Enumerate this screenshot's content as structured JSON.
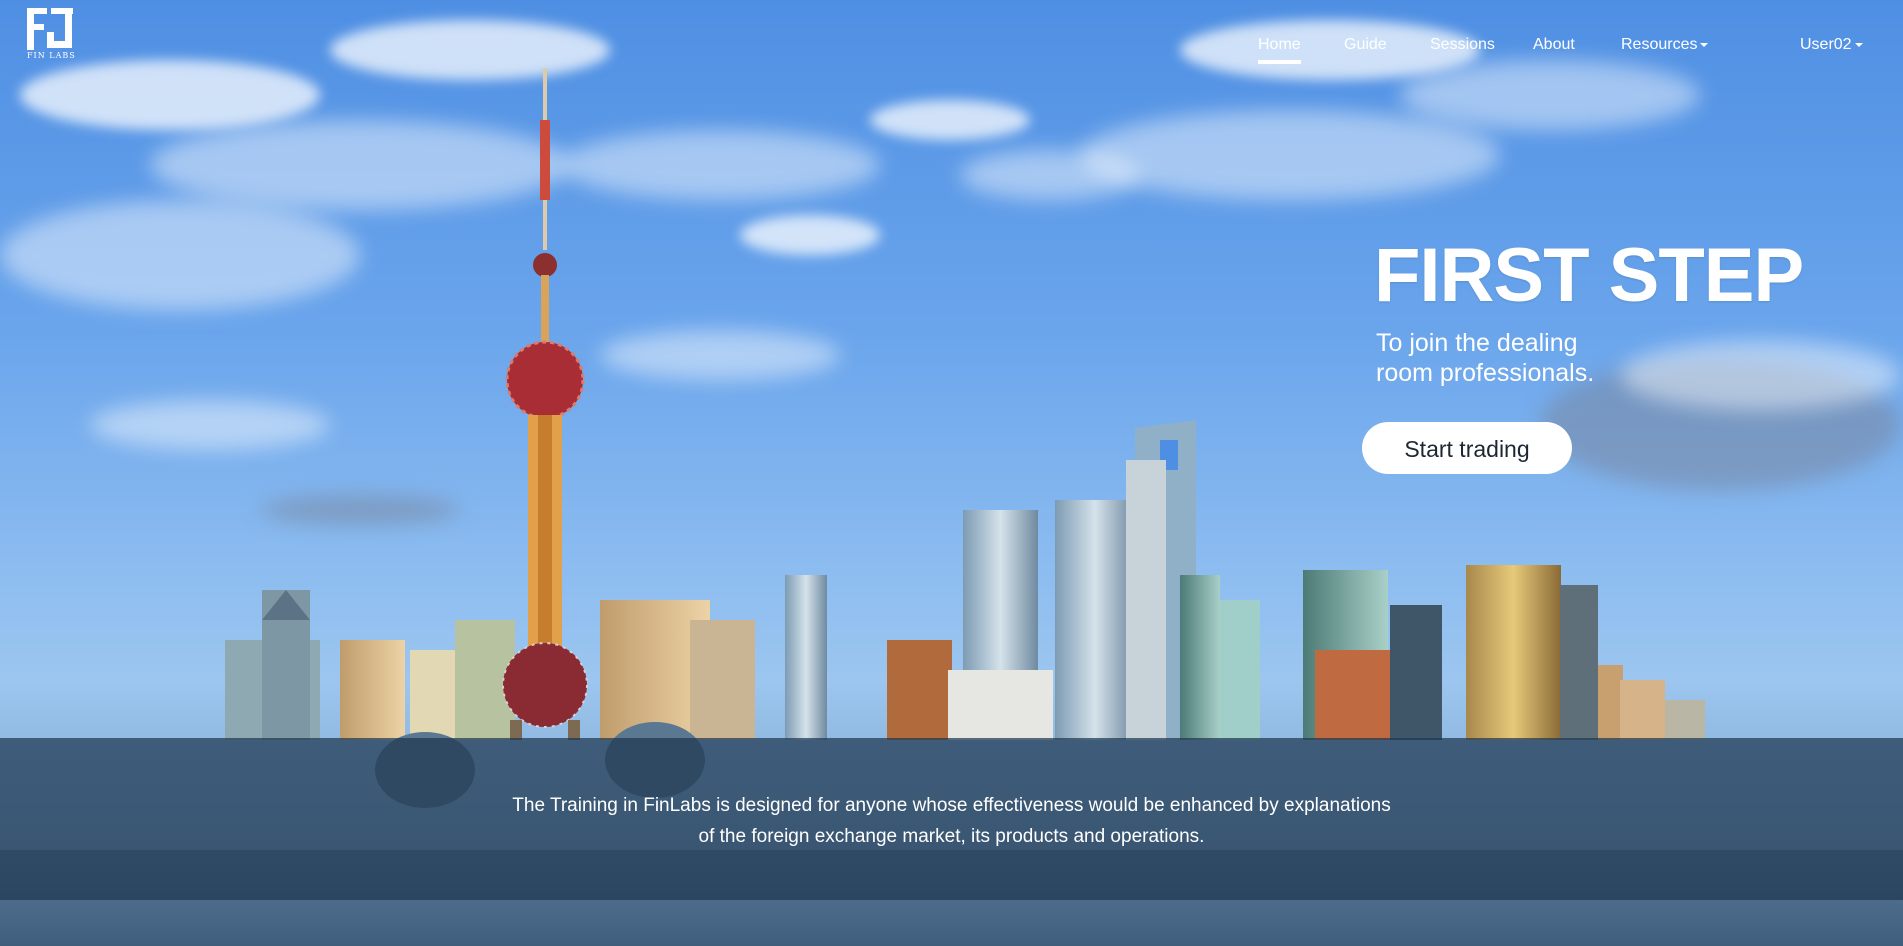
{
  "brand": {
    "logo_text": "FIN LABS",
    "accent": "#ffffff"
  },
  "nav": {
    "items": [
      {
        "label": "Home",
        "active": true
      },
      {
        "label": "Guide",
        "active": false
      },
      {
        "label": "Sessions",
        "active": false
      },
      {
        "label": "About",
        "active": false
      },
      {
        "label": "Resources",
        "active": false,
        "dropdown": true
      }
    ],
    "user": {
      "label": "User02",
      "dropdown": true
    }
  },
  "hero": {
    "title": "FIRST STEP",
    "subtitle": "To join the dealing room professionals.",
    "cta_label": "Start trading"
  },
  "info": {
    "line1": "The Training in FinLabs is designed for anyone whose effectiveness would be enhanced by explanations",
    "line2": "of the foreign exchange market, its products and operations."
  },
  "colors": {
    "sky": "#6aa5ec",
    "band": "#1e3750",
    "button_text": "#1d2733"
  }
}
